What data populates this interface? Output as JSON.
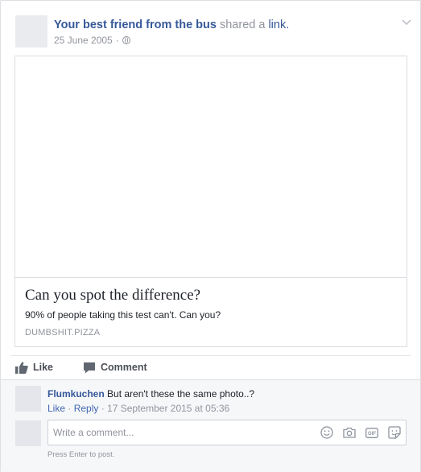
{
  "post": {
    "author": "Your best friend from the bus",
    "action_text": "shared a",
    "action_link": "link.",
    "date": "25 June 2005",
    "separator": "·"
  },
  "link": {
    "title": "Can you spot the difference?",
    "description": "90% of people taking this test can't. Can you?",
    "domain": "DUMBSHIT.PIZZA"
  },
  "actions": {
    "like": "Like",
    "comment": "Comment"
  },
  "comment": {
    "author": "Flumkuchen",
    "text": "But aren't these the same photo..?",
    "like": "Like",
    "dot": "·",
    "reply": "Reply",
    "timestamp": "· 17 September 2015 at 05:36"
  },
  "reply_box": {
    "placeholder": "Write a comment...",
    "hint": "Press Enter to post."
  },
  "colors": {
    "link": "#365899",
    "muted": "#90949c",
    "background": "#e9ebee"
  }
}
